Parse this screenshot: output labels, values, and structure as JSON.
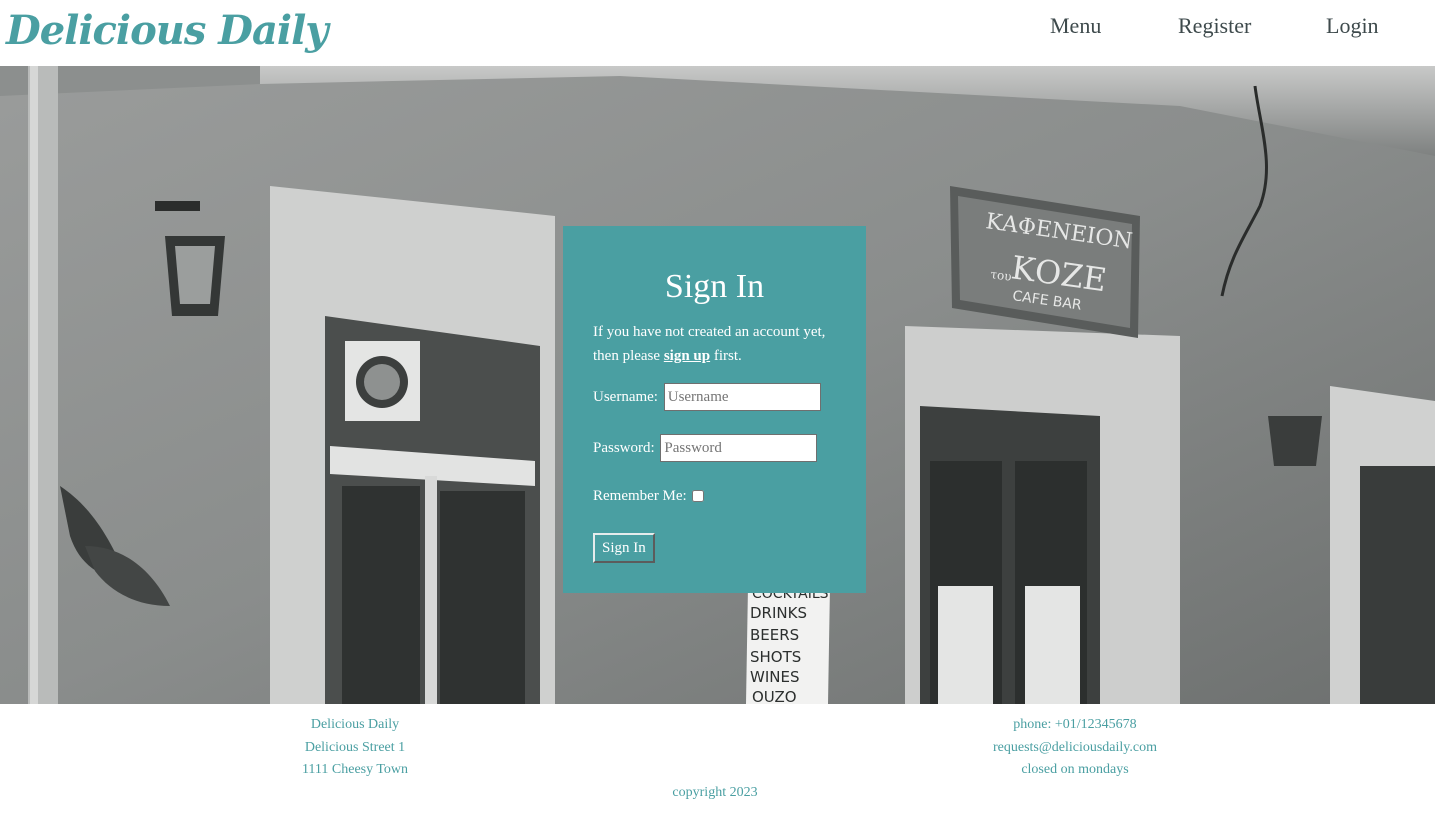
{
  "header": {
    "brand": "Delicious Daily",
    "nav": {
      "menu": "Menu",
      "register": "Register",
      "login": "Login"
    }
  },
  "signin": {
    "title": "Sign In",
    "intro_before": "If you have not created an account yet, then please ",
    "intro_link": "sign up",
    "intro_after": " first.",
    "username_label": "Username:",
    "username_placeholder": "Username",
    "password_label": "Password:",
    "password_placeholder": "Password",
    "remember_label": "Remember Me:",
    "remember_checked": false,
    "button": "Sign In"
  },
  "hero_sign": {
    "line1": "ΚΑΦΕΝΕΙΟΝ",
    "small": "του",
    "line2": "ΚΟΖΕ",
    "line3": "CAFE BAR"
  },
  "hero_board": [
    "COCKTAILS",
    "DRINKS",
    "BEERS",
    "SHOTS",
    "WINES",
    "OUZO"
  ],
  "footer": {
    "left": [
      "Delicious Daily",
      "Delicious Street 1",
      "1111 Cheesy Town"
    ],
    "right": [
      "phone: +01/12345678",
      "requests@deliciousdaily.com",
      "closed on mondays"
    ],
    "copyright": "copyright 2023"
  },
  "colors": {
    "accent": "#4a9fa2",
    "nav_text": "#3e4a4c",
    "panel_text": "#ffffff"
  }
}
